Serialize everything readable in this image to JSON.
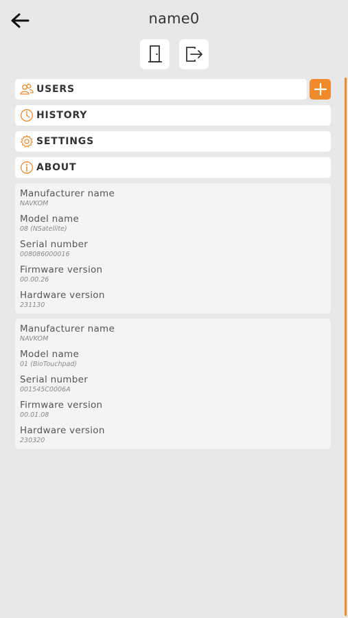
{
  "header": {
    "title": "name0"
  },
  "colors": {
    "accent": "#f08a2a",
    "background": "#e8e8e8"
  },
  "toolbar": {
    "back_icon": "arrow-left-icon",
    "door_icon": "door-icon",
    "logout_icon": "logout-icon"
  },
  "menu": {
    "items": [
      {
        "label": "USERS",
        "icon": "users-icon"
      },
      {
        "label": "HISTORY",
        "icon": "clock-icon"
      },
      {
        "label": "SETTINGS",
        "icon": "gear-icon"
      },
      {
        "label": "ABOUT",
        "icon": "info-icon"
      }
    ],
    "add_icon": "plus-icon"
  },
  "devices": [
    {
      "fields": [
        {
          "label": "Manufacturer name",
          "value": "NAVKOM"
        },
        {
          "label": "Model name",
          "value": "08 (NSatellite)"
        },
        {
          "label": "Serial number",
          "value": "008086000016"
        },
        {
          "label": "Firmware version",
          "value": "00.00.26"
        },
        {
          "label": "Hardware version",
          "value": "231130"
        }
      ]
    },
    {
      "fields": [
        {
          "label": "Manufacturer name",
          "value": "NAVKOM"
        },
        {
          "label": "Model name",
          "value": "01 (BioTouchpad)"
        },
        {
          "label": "Serial number",
          "value": "001545C0006A"
        },
        {
          "label": "Firmware version",
          "value": "00.01.08"
        },
        {
          "label": "Hardware version",
          "value": "230320"
        }
      ]
    }
  ]
}
